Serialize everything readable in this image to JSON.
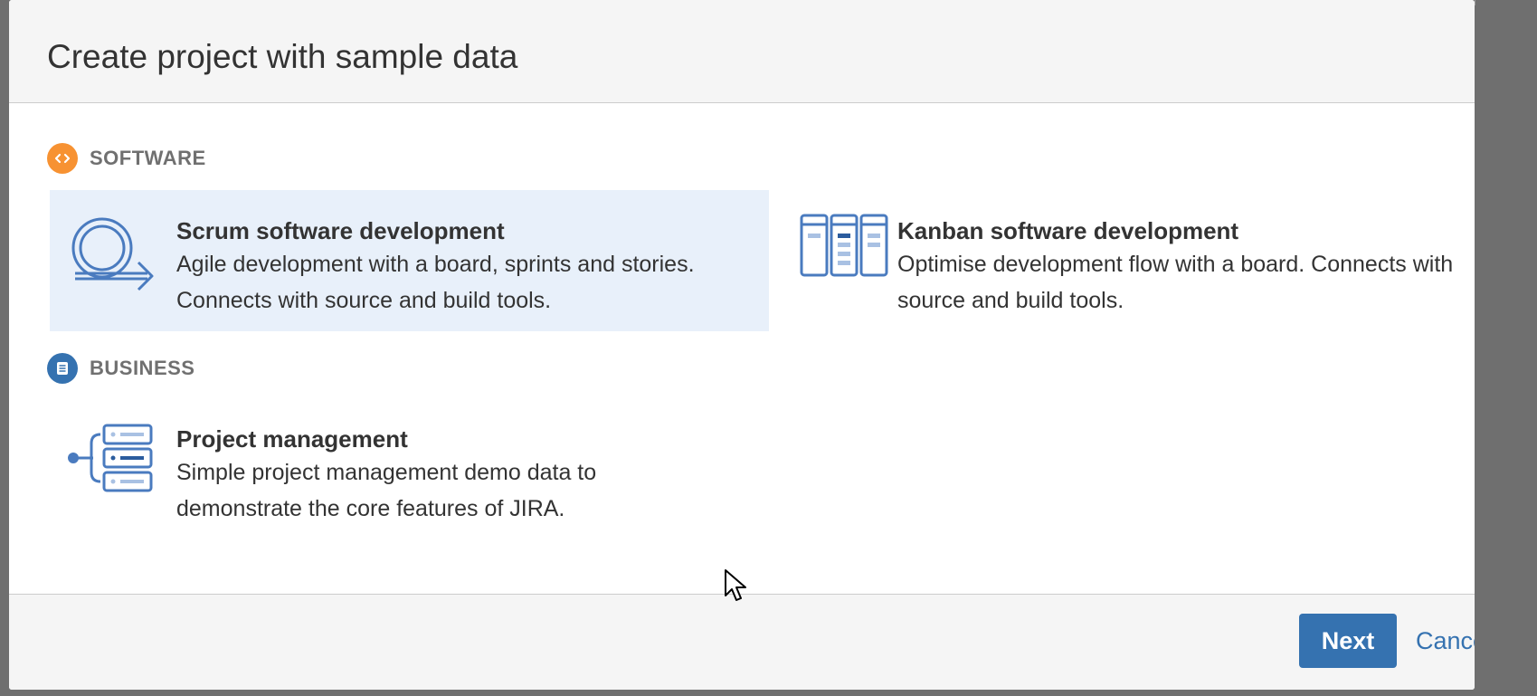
{
  "dialog": {
    "title": "Create project with sample data"
  },
  "sections": [
    {
      "label": "SOFTWARE",
      "icon": "code-brackets-icon",
      "color": "#f79232",
      "templates": [
        {
          "name": "Scrum software development",
          "description": "Agile development with a board, sprints and stories. Connects with source and build tools.",
          "icon": "scrum-cycle-icon",
          "selected": true
        },
        {
          "name": "Kanban software development",
          "description": "Optimise development flow with a board. Connects with source and build tools.",
          "icon": "kanban-board-icon",
          "selected": false
        }
      ]
    },
    {
      "label": "BUSINESS",
      "icon": "document-lines-icon",
      "color": "#3572b0",
      "templates": [
        {
          "name": "Project management",
          "description": "Simple project management demo data to demonstrate the core features of JIRA.",
          "icon": "project-tree-icon",
          "selected": false
        }
      ]
    }
  ],
  "footer": {
    "next_label": "Next",
    "cancel_label": "Cancel"
  },
  "colors": {
    "accent": "#3572b0",
    "selected_bg": "#e8f0fa",
    "software_badge": "#f79232",
    "business_badge": "#3572b0"
  }
}
